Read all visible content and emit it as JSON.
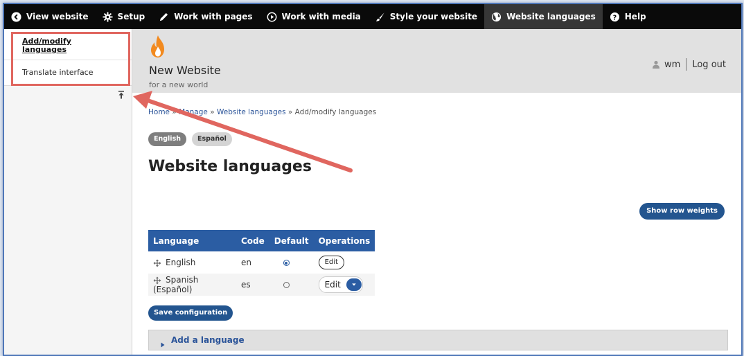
{
  "toolbar": {
    "items": [
      {
        "label": "View website",
        "icon": "chevron-left-circle-icon"
      },
      {
        "label": "Setup",
        "icon": "gear-icon"
      },
      {
        "label": "Work with pages",
        "icon": "pencil-icon"
      },
      {
        "label": "Work with media",
        "icon": "play-circle-icon"
      },
      {
        "label": "Style your website",
        "icon": "brush-icon"
      },
      {
        "label": "Website languages",
        "icon": "globe-icon"
      },
      {
        "label": "Help",
        "icon": "question-circle-icon"
      }
    ],
    "active": "Website languages"
  },
  "tray": {
    "items": [
      {
        "label": "Add/modify languages"
      },
      {
        "label": "Translate interface"
      }
    ]
  },
  "site": {
    "name": "New Website",
    "slogan": "for a new world",
    "logo_icon": "flame-icon"
  },
  "user": {
    "name": "wm",
    "logout": "Log out"
  },
  "breadcrumb": {
    "home": "Home",
    "sep1": "»",
    "manage": "Manage",
    "sep2": "»",
    "languages": "Website languages",
    "sep3": "»",
    "current": "Add/modify languages"
  },
  "lang_switch": [
    "English",
    "Español"
  ],
  "page_title": "Website languages",
  "show_row_weights": "Show row weights",
  "table": {
    "headers": [
      "Language",
      "Code",
      "Default",
      "Operations"
    ],
    "rows": [
      {
        "language": "English",
        "code": "en",
        "default": true,
        "operation": "Edit"
      },
      {
        "language": "Spanish (Español)",
        "code": "es",
        "default": false,
        "operation": "Edit"
      }
    ]
  },
  "save_label": "Save configuration",
  "add_language_label": "Add a language",
  "colors": {
    "toolbar": "#0a0a0a",
    "accent": "#2b5da3",
    "annotation": "#e0665f"
  }
}
